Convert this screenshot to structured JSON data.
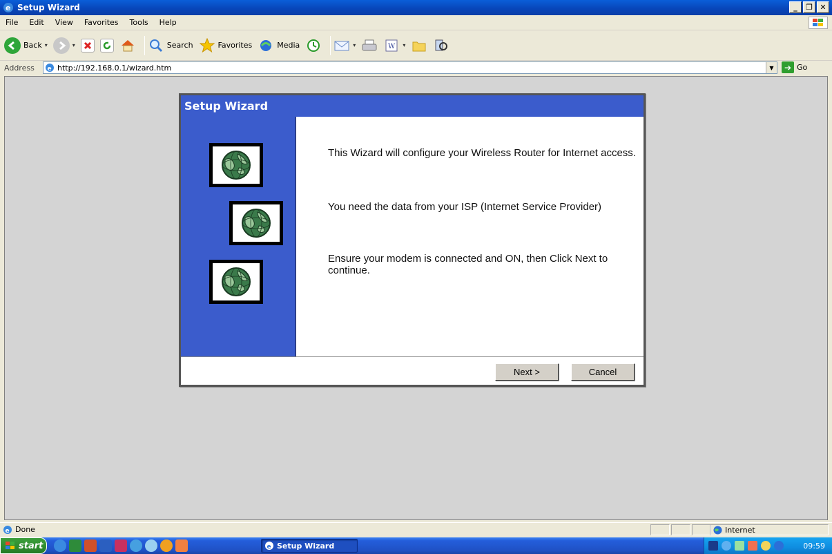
{
  "window": {
    "title": "Setup Wizard"
  },
  "menu": [
    "File",
    "Edit",
    "View",
    "Favorites",
    "Tools",
    "Help"
  ],
  "toolbar": {
    "back_label": "Back",
    "search_label": "Search",
    "favorites_label": "Favorites",
    "media_label": "Media"
  },
  "address": {
    "label": "Address",
    "url": "http://192.168.0.1/wizard.htm",
    "go_label": "Go"
  },
  "wizard": {
    "title": "Setup Wizard",
    "paragraphs": [
      "This Wizard will configure your Wireless Router for Internet access.",
      "You need the data from your ISP (Internet Service Provider)",
      "Ensure your modem is connected and ON, then Click Next to continue."
    ],
    "next_label": "Next >",
    "cancel_label": "Cancel"
  },
  "status": {
    "text": "Done",
    "zone": "Internet"
  },
  "taskbar": {
    "start_label": "start",
    "task_label": "Setup Wizard",
    "clock": "09:59"
  },
  "colors": {
    "wizard_blue": "#3b5ccc",
    "title_blue": "#0845b8",
    "page_gray": "#d4d4d4"
  }
}
